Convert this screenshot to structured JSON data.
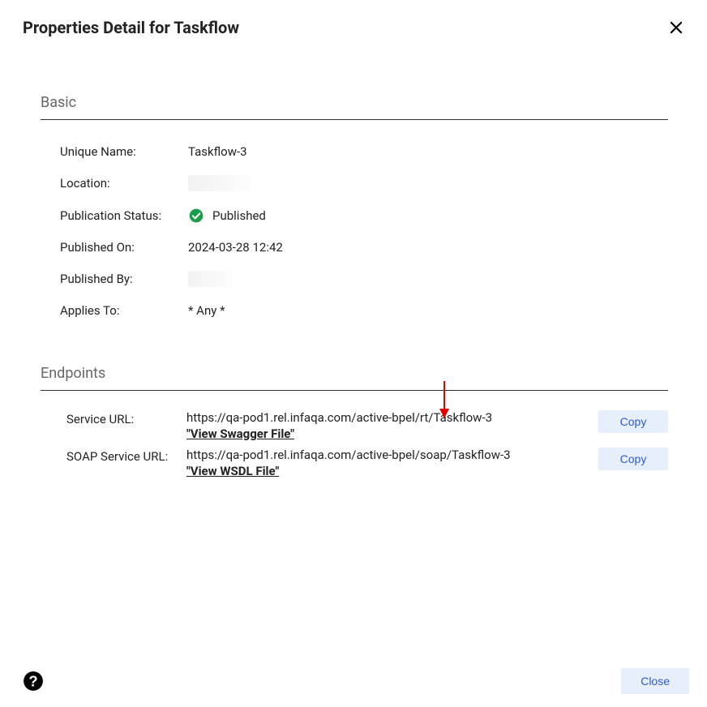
{
  "dialog": {
    "title": "Properties Detail for Taskflow",
    "close_btn": "Close"
  },
  "sections": {
    "basic": {
      "heading": "Basic",
      "labels": {
        "unique_name": "Unique Name:",
        "location": "Location:",
        "pub_status": "Publication Status:",
        "pub_on": "Published On:",
        "pub_by": "Published By:",
        "applies_to": "Applies To:"
      },
      "values": {
        "unique_name": "Taskflow-3",
        "pub_status": "Published",
        "pub_on": "2024-03-28 12:42",
        "applies_to": "* Any *"
      }
    },
    "endpoints": {
      "heading": "Endpoints",
      "service": {
        "label": "Service URL:",
        "url": "https://qa-pod1.rel.infaqa.com/active-bpel/rt/Taskflow-3",
        "link": "\"View Swagger File\"",
        "copy": "Copy"
      },
      "soap": {
        "label": "SOAP Service URL:",
        "url": "https://qa-pod1.rel.infaqa.com/active-bpel/soap/Taskflow-3",
        "link": "\"View WSDL File\"",
        "copy": "Copy"
      }
    }
  }
}
